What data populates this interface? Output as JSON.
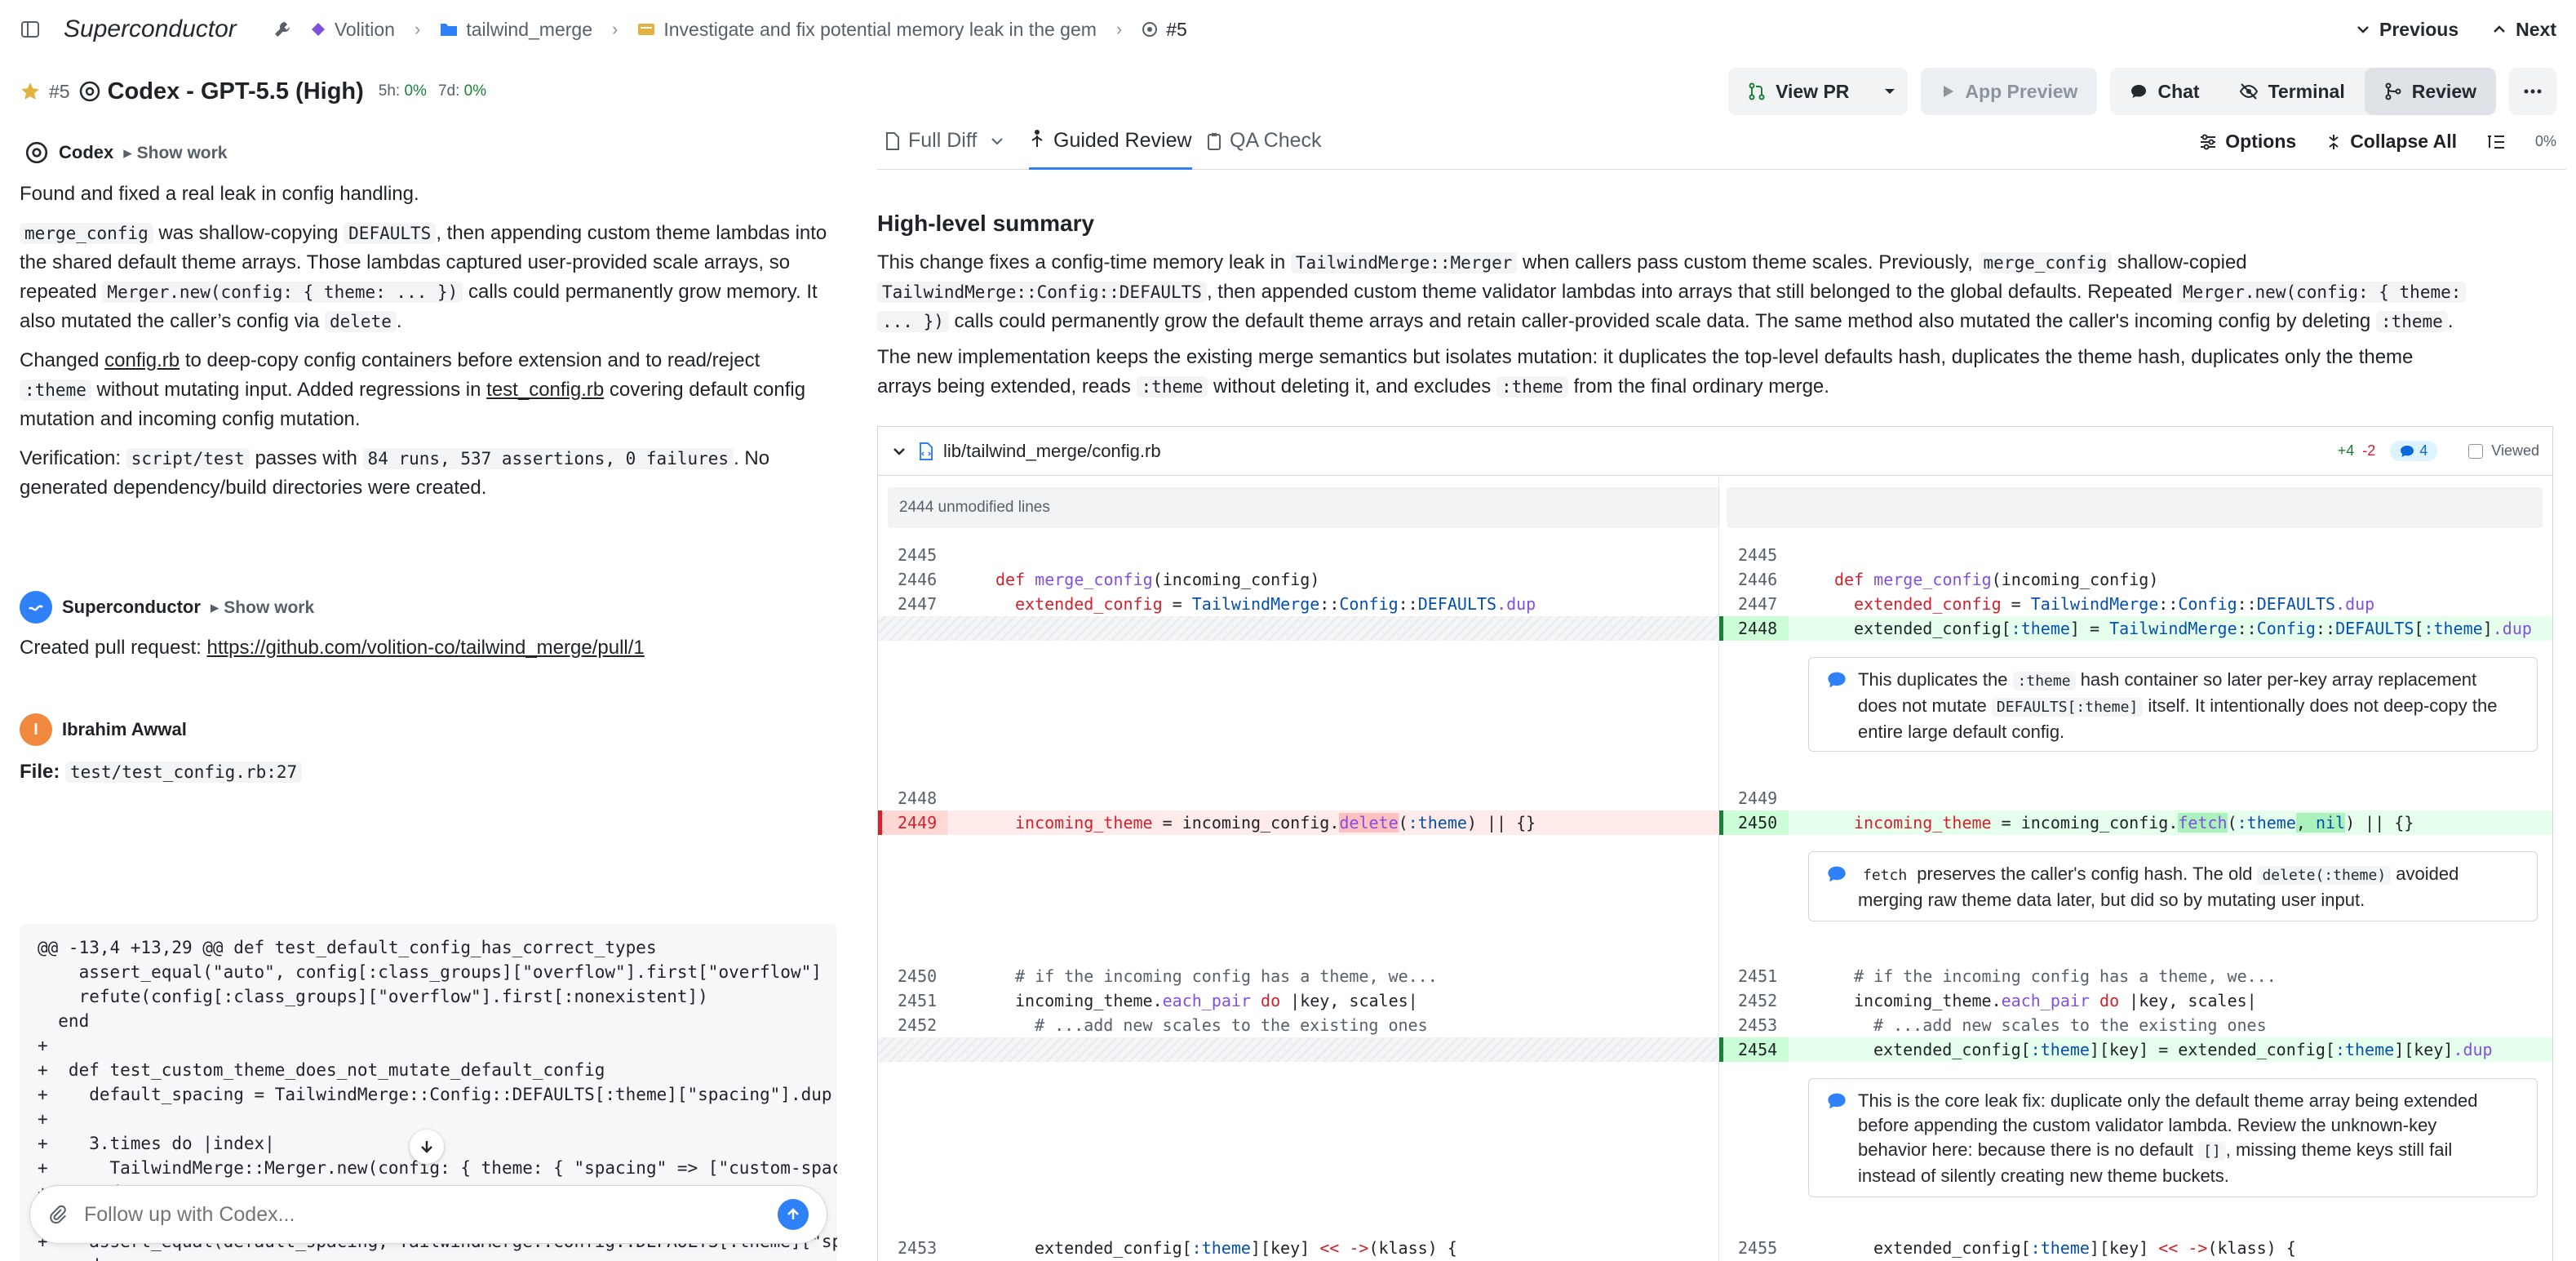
{
  "app": {
    "title": "Superconductor",
    "breadcrumb": [
      "Volition",
      "tailwind_merge",
      "Investigate and fix potential memory leak in the gem",
      "#5"
    ],
    "previous_label": "Previous",
    "next_label": "Next"
  },
  "session": {
    "number": "#5",
    "title": "Codex - GPT-5.5 (High)",
    "usage_5h_label": "5h:",
    "usage_5h_value": "0%",
    "usage_7d_label": "7d:",
    "usage_7d_value": "0%"
  },
  "toolbar": {
    "view_pr": "View PR",
    "app_preview": "App Preview",
    "chat": "Chat",
    "terminal": "Terminal",
    "review": "Review"
  },
  "chat": {
    "codex_name": "Codex",
    "show_work": "Show work",
    "msg1_p1": "Found and fixed a real leak in config handling.",
    "msg1_p2a": "merge_config",
    "msg1_p2b": " was shallow-copying ",
    "msg1_p2c": "DEFAULTS",
    "msg1_p2d": ", then appending custom theme lambdas into the shared default theme arrays. Those lambdas captured user-provided scale arrays, so repeated ",
    "msg1_p2e": "Merger.new(config: { theme: ... })",
    "msg1_p2f": " calls could permanently grow memory. It also mutated the caller’s config via ",
    "msg1_p2g": "delete",
    "msg1_p2h": ".",
    "msg1_p3a": "Changed ",
    "msg1_p3b": "config.rb",
    "msg1_p3c": " to deep-copy config containers before extension and to read/reject ",
    "msg1_p3d": ":theme",
    "msg1_p3e": " without mutating input. Added regressions in ",
    "msg1_p3f": "test_config.rb",
    "msg1_p3g": " covering default config mutation and incoming config mutation.",
    "msg1_p4a": "Verification: ",
    "msg1_p4b": "script/test",
    "msg1_p4c": " passes with ",
    "msg1_p4d": "84 runs, 537 assertions, 0 failures",
    "msg1_p4e": ". No generated dependency/build directories were created.",
    "sc_name": "Superconductor",
    "sc_show_work": "Show work",
    "sc_msg_label": "Created pull request: ",
    "sc_msg_link": "https://github.com/volition-co/tailwind_merge/pull/1",
    "user_initial": "I",
    "user_name": "Ibrahim Awwal",
    "file_label": "File:",
    "file_value": "test/test_config.rb:27",
    "code_lines": [
      "@@ -13,4 +13,29 @@ def test_default_config_has_correct_types",
      "    assert_equal(\"auto\", config[:class_groups][\"overflow\"].first[\"overflow\"]",
      "    refute(config[:class_groups][\"overflow\"].first[:nonexistent])",
      "  end",
      "+",
      "+  def test_custom_theme_does_not_mutate_default_config",
      "+    default_spacing = TailwindMerge::Config::DEFAULTS[:theme][\"spacing\"].dup",
      "+",
      "+    3.times do |index|",
      "+      TailwindMerge::Merger.new(config: { theme: { \"spacing\" => [\"custom-spac",
      "+    end",
      "+",
      "+    assert_equal(default_spacing, TailwindMerge::Config::DEFAULTS[:theme][\"sp",
      "+  end",
      "+"
    ],
    "input_placeholder": "Follow up with Codex..."
  },
  "review": {
    "tabs": [
      "Full Diff",
      "Guided Review",
      "QA Check"
    ],
    "options": "Options",
    "collapse_all": "Collapse All",
    "progress": "0%",
    "summary_title": "High-level summary",
    "s1_a": "This change fixes a config-time memory leak in ",
    "s1_b": "TailwindMerge::Merger",
    "s1_c": " when callers pass custom theme scales. Previously, ",
    "s1_d": "merge_config",
    "s1_e": " shallow-copied",
    "s1_f": "TailwindMerge::Config::DEFAULTS",
    "s1_g": ", then appended custom theme validator lambdas into arrays that still belonged to the global defaults. Repeated ",
    "s1_h": "Merger.new(config: { theme:",
    "s1_i": "... })",
    "s1_j": " calls could permanently grow the default theme arrays and retain caller-provided scale data. The same method also mutated the caller's incoming config by deleting ",
    "s1_k": ":theme",
    "s1_l": ".",
    "s2_a": "The new implementation keeps the existing merge semantics but isolates mutation: it duplicates the top-level defaults hash, duplicates the theme hash, duplicates only the theme",
    "s2_b": "arrays being extended, reads ",
    "s2_c": ":theme",
    "s2_d": " without deleting it, and excludes ",
    "s2_e": ":theme",
    "s2_f": " from the final ordinary merge.",
    "file_path": "lib/tailwind_merge/config.rb",
    "additions": "+4",
    "deletions": "-2",
    "comment_count": "4",
    "viewed": "Viewed",
    "unmodified": "2444 unmodified lines",
    "c1_a": "This duplicates the ",
    "c1_b": ":theme",
    "c1_c": " hash container so later per-key array replacement",
    "c1_d": "does not mutate ",
    "c1_e": "DEFAULTS[:theme]",
    "c1_f": " itself. It intentionally does not deep-copy the",
    "c1_g": "entire large default config.",
    "c2_a": "fetch",
    "c2_b": " preserves the caller's config hash. The old ",
    "c2_c": "delete(:theme)",
    "c2_d": " avoided",
    "c2_e": "merging raw theme data later, but did so by mutating user input.",
    "c3_a": "This is the core leak fix: duplicate only the default theme array being extended",
    "c3_b": "before appending the custom validator lambda. Review the unknown-key",
    "c3_c": "behavior here: because there is no default ",
    "c3_d": "[]",
    "c3_e": ", missing theme keys still fail",
    "c3_f": "instead of silently creating new theme buckets.",
    "ln": {
      "l2445": "2445",
      "l2446": "2446",
      "l2447": "2447",
      "l2448": "2448",
      "l2449": "2449",
      "l2450": "2450",
      "l2451": "2451",
      "l2452": "2452",
      "l2453": "2453",
      "l2454": "2454",
      "l2455": "2455"
    },
    "code": {
      "def": "def ",
      "merge_config": "merge_config",
      "param": "(incoming_config)",
      "ext_cfg": "extended_config",
      "eq": " = ",
      "tw": "TailwindMerge",
      "cc": "::",
      "config": "Config",
      "defaults": "DEFAULTS",
      "dup": ".dup",
      "ext_theme": "extended_config[",
      "theme_sym": ":theme",
      "close": "] = ",
      "defaults_theme_tail": "[",
      "close2": "]",
      "incoming_theme": "incoming_theme",
      "incoming_cfg": "incoming_config.",
      "delete": "delete",
      "fetch": "fetch",
      "del_args": "(",
      "del_tail": ") || {}",
      "fetch_tail_a": ", ",
      "nil": "nil",
      "fetch_tail_b": ") || {}",
      "comment1": "# if the incoming config has a theme, we...",
      "each_pair_a": "incoming_theme.",
      "each_pair": "each_pair",
      "each_pair_b": " do",
      "each_pair_c": " |key, scales|",
      "comment2": "# ...add new scales to the existing ones",
      "ext_key_a": "extended_config[",
      "ext_key_b": "][key] = extended_config[",
      "ext_key_c": "][key]",
      "last_a": "extended_config[",
      "last_b": "][key] ",
      "last_c": "<<",
      "last_d": " ",
      "last_e": "->",
      "last_f": "(klass) {"
    }
  }
}
